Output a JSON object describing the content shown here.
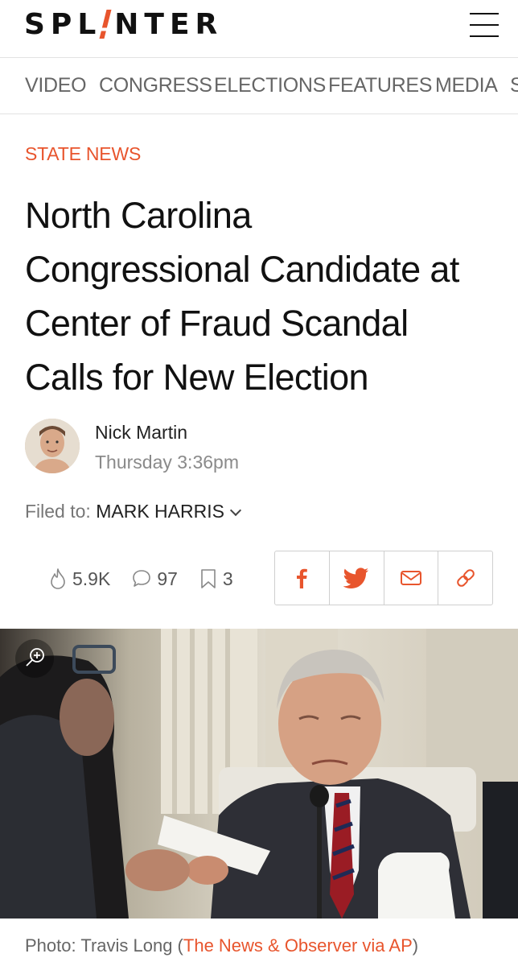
{
  "header": {
    "logo_before": "SPL",
    "logo_after": "NTER",
    "menu_icon": "hamburger-menu-icon"
  },
  "nav": {
    "items": [
      "VIDEO",
      "CONGRESS",
      "ELECTIONS",
      "FEATURES",
      "MEDIA",
      "S"
    ]
  },
  "article": {
    "section": "STATE NEWS",
    "headline_lines": [
      "North Carolina",
      "Congressional Candidate at",
      "Center of Fraud Scandal",
      "Calls for New Election"
    ],
    "author": "Nick Martin",
    "timestamp": "Thursday 3:36pm",
    "filed_label": "Filed to:",
    "filed_tag": "MARK HARRIS"
  },
  "stats": {
    "views": "5.9K",
    "comments": "97",
    "bookmarks": "3"
  },
  "share": {
    "icons": [
      "facebook-icon",
      "twitter-icon",
      "email-icon",
      "link-icon"
    ],
    "accent": "#e8552d"
  },
  "photo": {
    "caption_prefix": "Photo: Travis Long (",
    "caption_link": "The News & Observer via AP",
    "caption_suffix": ")"
  },
  "colors": {
    "accent": "#e8552d",
    "text": "#111111",
    "muted": "#666666"
  }
}
